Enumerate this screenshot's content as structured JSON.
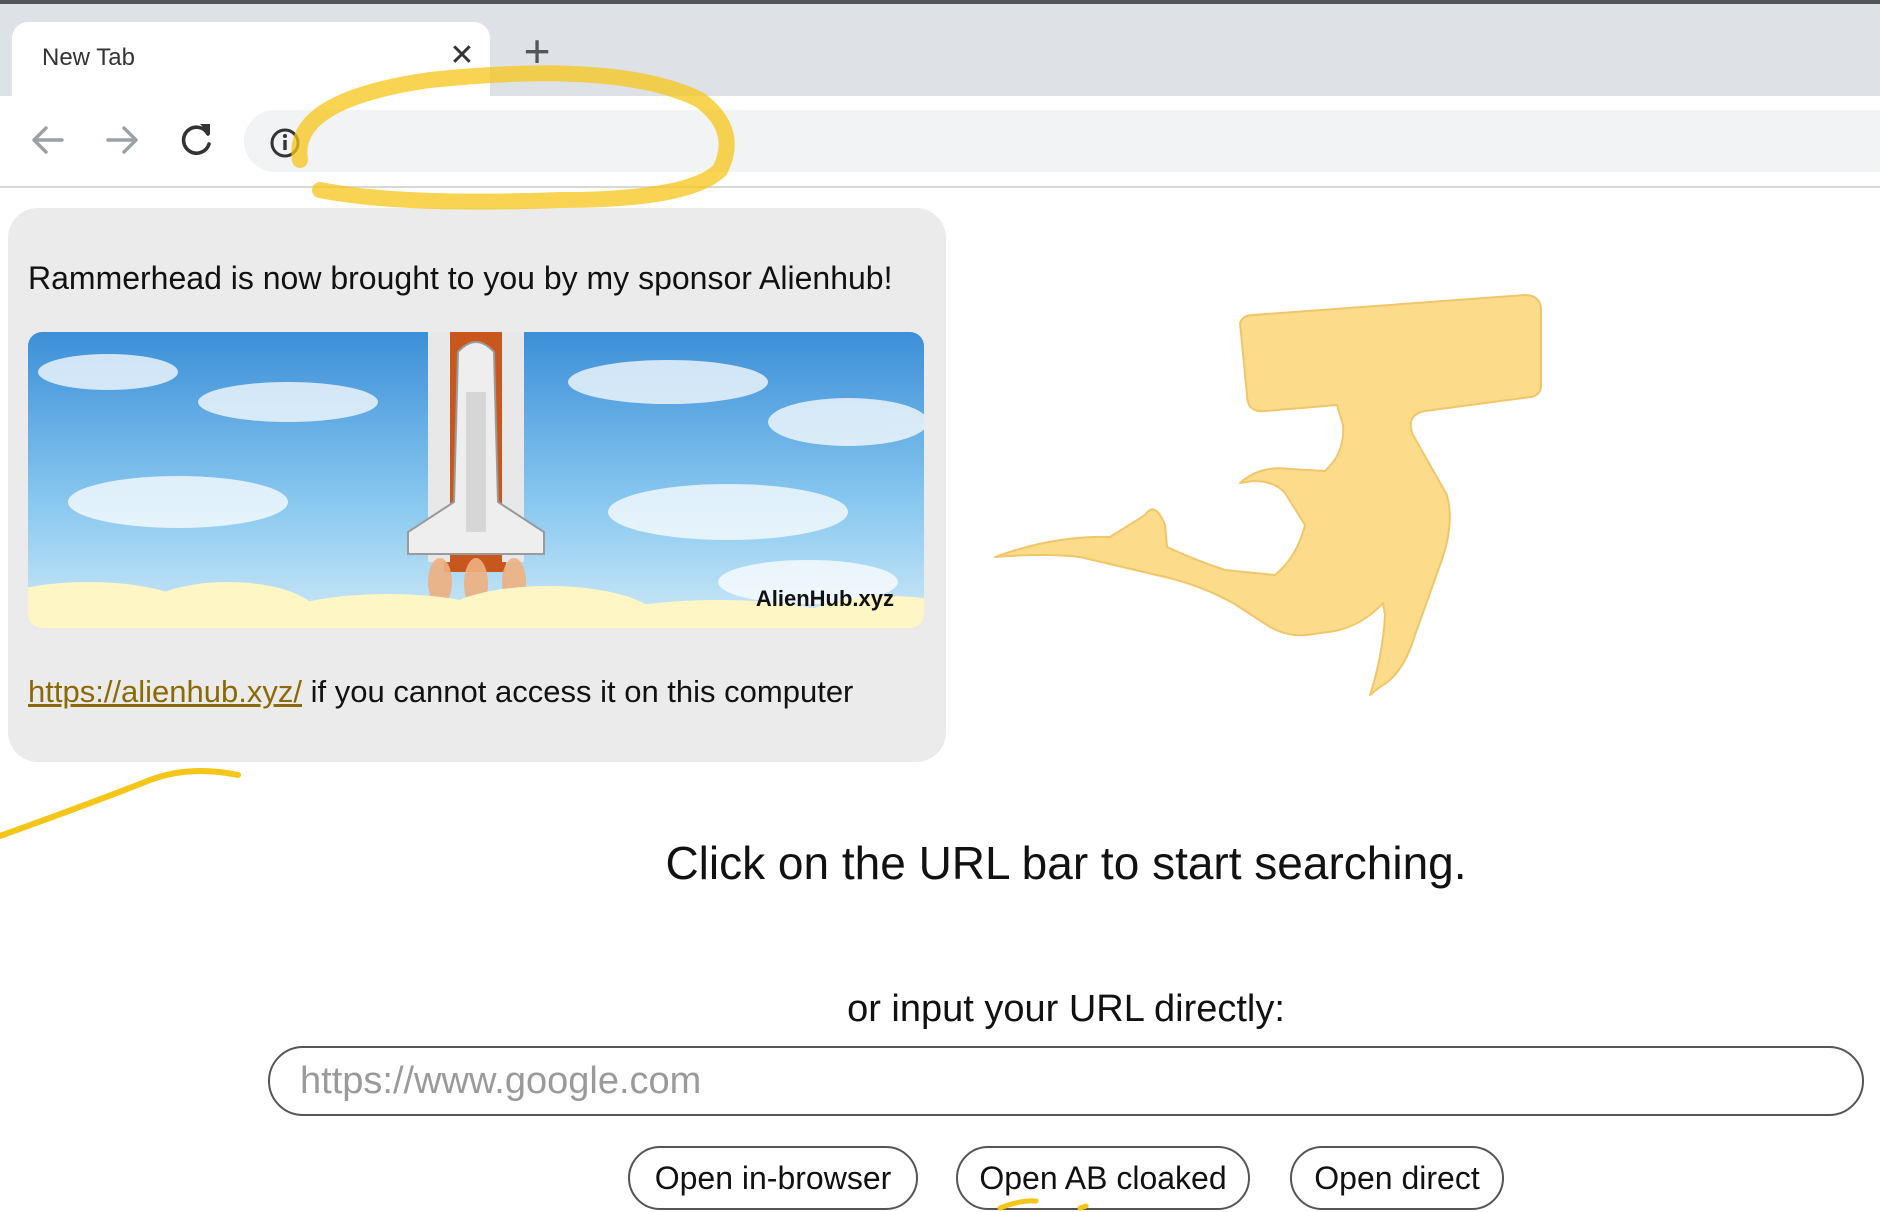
{
  "browser": {
    "tab": {
      "title": "New Tab",
      "close_icon": "close-icon"
    },
    "new_tab_icon": "plus-icon",
    "toolbar": {
      "back_icon": "arrow-left-icon",
      "forward_icon": "arrow-right-icon",
      "reload_icon": "reload-icon",
      "site_info_icon": "info-icon"
    }
  },
  "sponsor": {
    "message": "Rammerhead is now brought to you by my sponsor Alienhub!",
    "banner_watermark": "AlienHub.xyz",
    "link_text": "https://alienhub.xyz/",
    "footer_suffix": " if you cannot access it on this computer"
  },
  "logo": {
    "icon": "hammerhead-shark-logo",
    "color": "#fcdb8b"
  },
  "main": {
    "prompt": "Click on the URL bar to start searching.",
    "direct_label": "or input your URL directly:",
    "url_placeholder": "https://www.google.com",
    "buttons": {
      "open_in_browser": "Open in-browser",
      "open_ab_cloaked": "Open AB cloaked",
      "open_direct": "Open direct"
    }
  },
  "colors": {
    "tab_bar": "#dee1e6",
    "card_bg": "#ebebeb",
    "link": "#8b6a06",
    "annotation": "#f5c518"
  }
}
